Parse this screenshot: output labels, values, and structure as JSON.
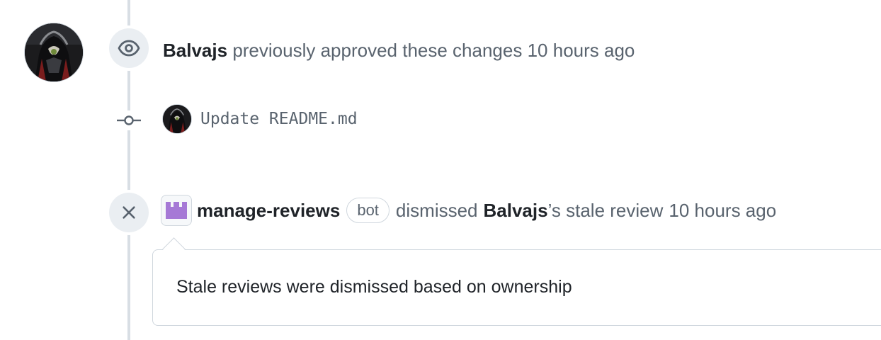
{
  "events": {
    "approval": {
      "icon": "eye-icon",
      "actor": "Balvajs",
      "text": "previously approved these changes",
      "time": "10 hours ago"
    },
    "commit": {
      "icon": "git-commit-icon",
      "message": "Update README.md"
    },
    "dismissal": {
      "icon": "x-icon",
      "actor": "manage-reviews",
      "actor_badge": "bot",
      "verb": "dismissed",
      "target": "Balvajs",
      "suffix": "’s stale review",
      "time": "10 hours ago",
      "comment": "Stale reviews were dismissed based on ownership"
    }
  },
  "colors": {
    "timeline": "#d8dee4",
    "badge_bg": "#eaeef2",
    "muted_text": "#59636e",
    "primary_text": "#1f2328",
    "bot_avatar": "#a679d6"
  }
}
